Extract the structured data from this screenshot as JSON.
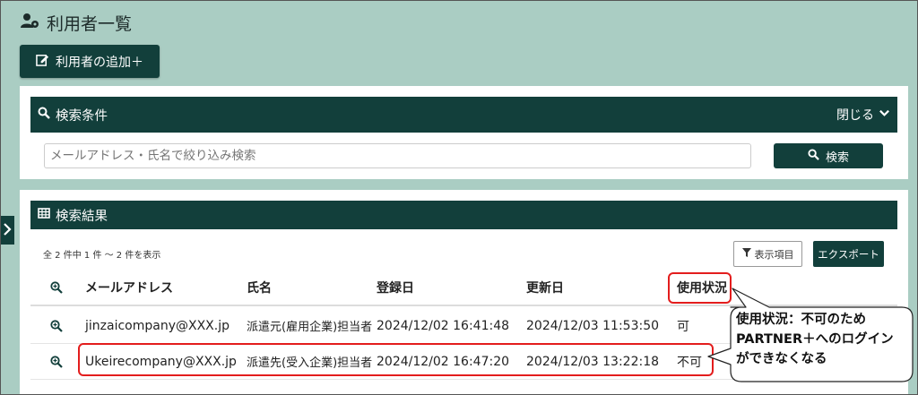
{
  "page": {
    "title": "利用者一覧"
  },
  "toolbar": {
    "add_user_label": "利用者の追加＋"
  },
  "search_panel": {
    "header": "検索条件",
    "collapse_label": "閉じる",
    "input_placeholder": "メールアドレス・氏名で絞り込み検索",
    "button_label": "検索"
  },
  "results_panel": {
    "header": "検索結果",
    "count_text": "全 2 件中 1 件 ～ 2 件を表示",
    "columns_button": "表示項目",
    "export_button": "エクスポート",
    "columns": [
      "メールアドレス",
      "氏名",
      "登録日",
      "更新日",
      "使用状況"
    ],
    "rows": [
      {
        "email": "jinzaicompany@XXX.jp",
        "name": "派遣元(雇用企業)担当者",
        "registered": "2024/12/02 16:41:48",
        "updated": "2024/12/03 11:53:50",
        "status": "可"
      },
      {
        "email": "Ukeirecompany@XXX.jp",
        "name": "派遣先(受入企業)担当者",
        "registered": "2024/12/02 16:47:20",
        "updated": "2024/12/03 13:22:18",
        "status": "不可"
      }
    ]
  },
  "annotation": {
    "lines": [
      "使用状況：不可のため",
      "PARTNER＋へのログイン",
      "ができなくなる"
    ]
  },
  "colors": {
    "primary": "#123f3b",
    "background": "#aacdc3",
    "highlight": "#e31d1d"
  }
}
